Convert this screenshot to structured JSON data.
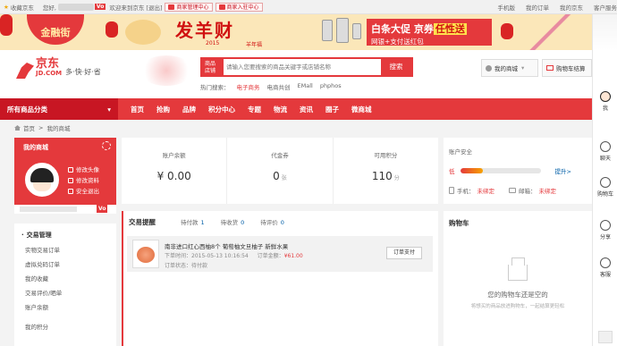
{
  "topbar": {
    "favorite": "收藏京东",
    "hello": "您好,",
    "vo_badge": "Vo",
    "welcome": "欢迎来到京东 [退出]",
    "merchant_admin": "商家管理中心",
    "merchant_join": "商家入驻中心",
    "right_links": [
      "手机版",
      "我的订单",
      "我的京东",
      "客户服务"
    ]
  },
  "banner": {
    "finance": "金融街",
    "headline": "发羊财",
    "year": "2015",
    "sheep_year": "羊年福",
    "promo_line1_prefix": "白条大促 京券",
    "promo_line1_highlight": "任性送",
    "promo_line2": "网银+支付送红包"
  },
  "header": {
    "logo_main": "京东",
    "logo_sub": "JD.COM",
    "slogan": "多·快·好·省",
    "search_tag": "商品 店铺",
    "search_placeholder": "请输入您要搜索的商品关键字或店铺名称",
    "search_button": "搜索",
    "hot_label": "热门搜索：",
    "hot_items": [
      "电子商务",
      "电商共创",
      "EMall",
      "phphos"
    ],
    "my_mall": "我的商城",
    "cart": "购物车结算"
  },
  "nav": {
    "all_categories": "所有商品分类",
    "items": [
      "首页",
      "抢购",
      "品牌",
      "积分中心",
      "专题",
      "物流",
      "资讯",
      "圈子",
      "微商城"
    ]
  },
  "breadcrumb": {
    "home": "首页",
    "sep": ">",
    "current": "我的商城"
  },
  "profile": {
    "title": "我的商城",
    "links": [
      "修改头像",
      "修改资料",
      "安全退出"
    ],
    "vo_badge": "Vo"
  },
  "leftmenu": {
    "section1": "交易管理",
    "items": [
      "实物交易订单",
      "虚拟兑码订单",
      "我的收藏",
      "交易评价/晒单",
      "账户余额"
    ],
    "section2": "我的积分"
  },
  "stats": [
    {
      "label": "账户余额",
      "value": "¥ 0.00",
      "unit": ""
    },
    {
      "label": "代金券",
      "value": "0",
      "unit": "张"
    },
    {
      "label": "可用积分",
      "value": "110",
      "unit": "分"
    }
  ],
  "security": {
    "title": "账户安全",
    "level": "低",
    "level_progress": 0.28,
    "upgrade": "提升>",
    "phone_label": "手机：",
    "phone_status": "未绑定",
    "email_label": "邮箱：",
    "email_status": "未绑定"
  },
  "transactions": {
    "title": "交易提醒",
    "tabs": [
      {
        "label": "待付款",
        "count": "1"
      },
      {
        "label": "待收货",
        "count": "0"
      },
      {
        "label": "待评价",
        "count": "0"
      }
    ],
    "order": {
      "name": "南非进口红心西柚8个 葡萄柚文旦柚子 新鲜水果",
      "time_label": "下单时间：",
      "time": "2015-05-13 10:16:54",
      "amount_label": "订单金额：",
      "amount": "¥61.00",
      "state_label": "订单状态：",
      "state": "待付款",
      "pay_button": "订单支付"
    }
  },
  "cartpanel": {
    "title": "购物车",
    "empty": "您的购物车还是空的",
    "empty_hint": "将想买的商品放进购物车，一起结算更轻松"
  },
  "rightbar": [
    "我",
    "聊天",
    "购物车",
    "分享",
    "客服"
  ],
  "colors": {
    "brand": "#e4393c",
    "brand_dark": "#c81623",
    "link": "#005ea7"
  }
}
